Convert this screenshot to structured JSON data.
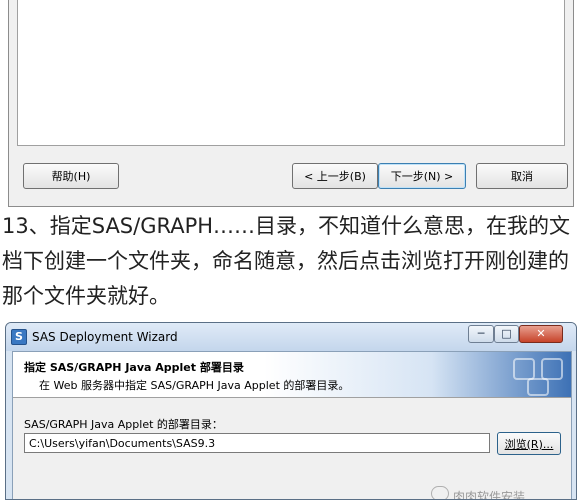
{
  "top_dialog": {
    "help_button": "帮助(H)",
    "back_button": "< 上一步(B)",
    "next_button": "下一步(N) >",
    "cancel_button": "取消"
  },
  "article": {
    "text": "13、指定SAS/GRAPH……目录，不知道什么意思，在我的文档下创建一个文件夹，命名随意，然后点击浏览打开刚创建的那个文件夹就好。"
  },
  "wizard": {
    "title": "SAS Deployment Wizard",
    "app_icon_letter": "S",
    "header_title": "指定 SAS/GRAPH Java Applet 部署目录",
    "header_subtitle": "在 Web 服务器中指定 SAS/GRAPH Java Applet 的部署目录。",
    "field_label": "SAS/GRAPH Java Applet 的部署目录：",
    "path_value": "C:\\Users\\yifan\\Documents\\SAS9.3",
    "browse_button": "浏览(R)...",
    "minimize_icon": "minimize-icon",
    "maximize_icon": "maximize-icon",
    "close_icon": "close-icon"
  },
  "watermark": {
    "text": "肉肉软件安装"
  },
  "colors": {
    "close_button": "#c7432a",
    "header_gradient_end": "#3d71b5",
    "article_text": "#222222"
  }
}
